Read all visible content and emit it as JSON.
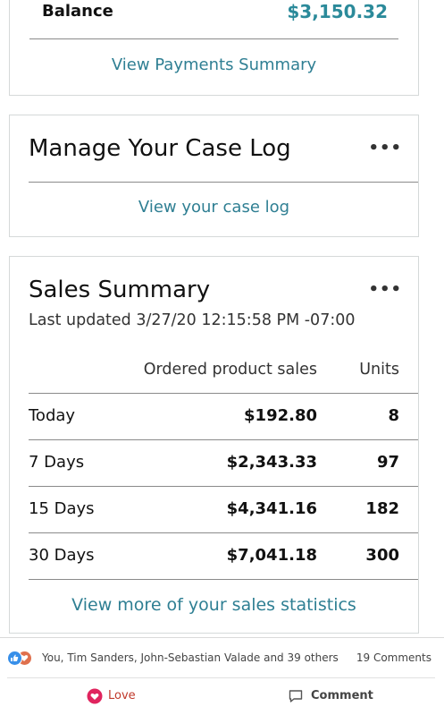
{
  "payments": {
    "balance_label": "Balance",
    "balance_value": "$3,150.32",
    "link": "View Payments Summary"
  },
  "case_log": {
    "title": "Manage Your Case Log",
    "menu": "•••",
    "link": "View your case log"
  },
  "sales": {
    "title": "Sales Summary",
    "menu": "•••",
    "updated": "Last updated 3/27/20 12:15:58 PM -07:00",
    "columns": {
      "sales": "Ordered product sales",
      "units": "Units"
    },
    "rows": [
      {
        "label": "Today",
        "sales": "$192.80",
        "units": "8"
      },
      {
        "label": "7 Days",
        "sales": "$2,343.33",
        "units": "97"
      },
      {
        "label": "15 Days",
        "sales": "$4,341.16",
        "units": "182"
      },
      {
        "label": "30 Days",
        "sales": "$7,041.18",
        "units": "300"
      }
    ],
    "link": "View more of your sales statistics"
  },
  "social": {
    "reaction_icons": [
      "like-icon",
      "love-icon"
    ],
    "reactions_text": "You, Tim Sanders, John-Sebastian Valade and 39 others",
    "comments_count": "19 Comments",
    "love_label": "Love",
    "comment_label": "Comment",
    "colors": {
      "like": "#378fe9",
      "love": "#df704d",
      "link": "#2f7f93"
    }
  }
}
